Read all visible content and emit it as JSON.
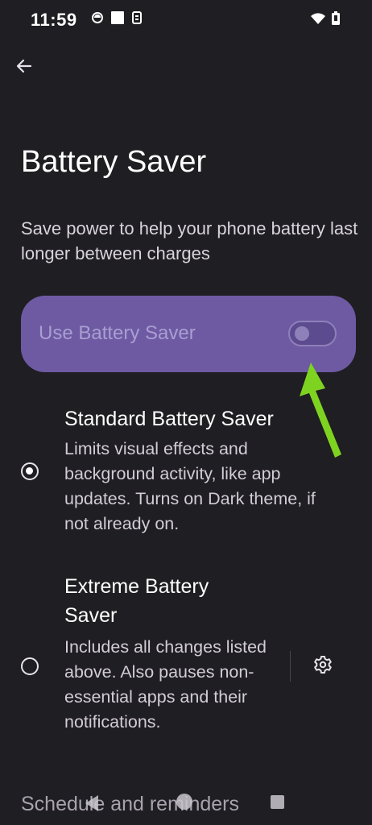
{
  "status_bar": {
    "time": "11:59",
    "left_icons": [
      "sim-icon",
      "square-notification-icon",
      "battery-saver-status-icon"
    ],
    "right_icons": [
      "wifi-icon",
      "battery-icon"
    ]
  },
  "header": {
    "back_icon": "arrow-back-icon",
    "title": "Battery Saver"
  },
  "description": "Save power to help your phone battery last longer between charges",
  "main_toggle": {
    "label": "Use Battery Saver",
    "state": "off",
    "card_color": "#6e5aa3"
  },
  "annotation": {
    "arrow_color": "#7ed321"
  },
  "options": [
    {
      "title": "Standard Battery Saver",
      "description": "Limits visual effects and background activity, like app updates. Turns on Dark theme, if not already on.",
      "selected": true
    },
    {
      "title": "Extreme Battery Saver",
      "description": "Includes all changes listed above. Also pauses non-essential apps and their notifications.",
      "selected": false,
      "settings_icon": "gear-icon"
    }
  ],
  "section_header": "Schedule and reminders",
  "nav_bar": {
    "buttons": [
      "nav-back-icon",
      "nav-home-icon",
      "nav-recents-icon"
    ]
  }
}
